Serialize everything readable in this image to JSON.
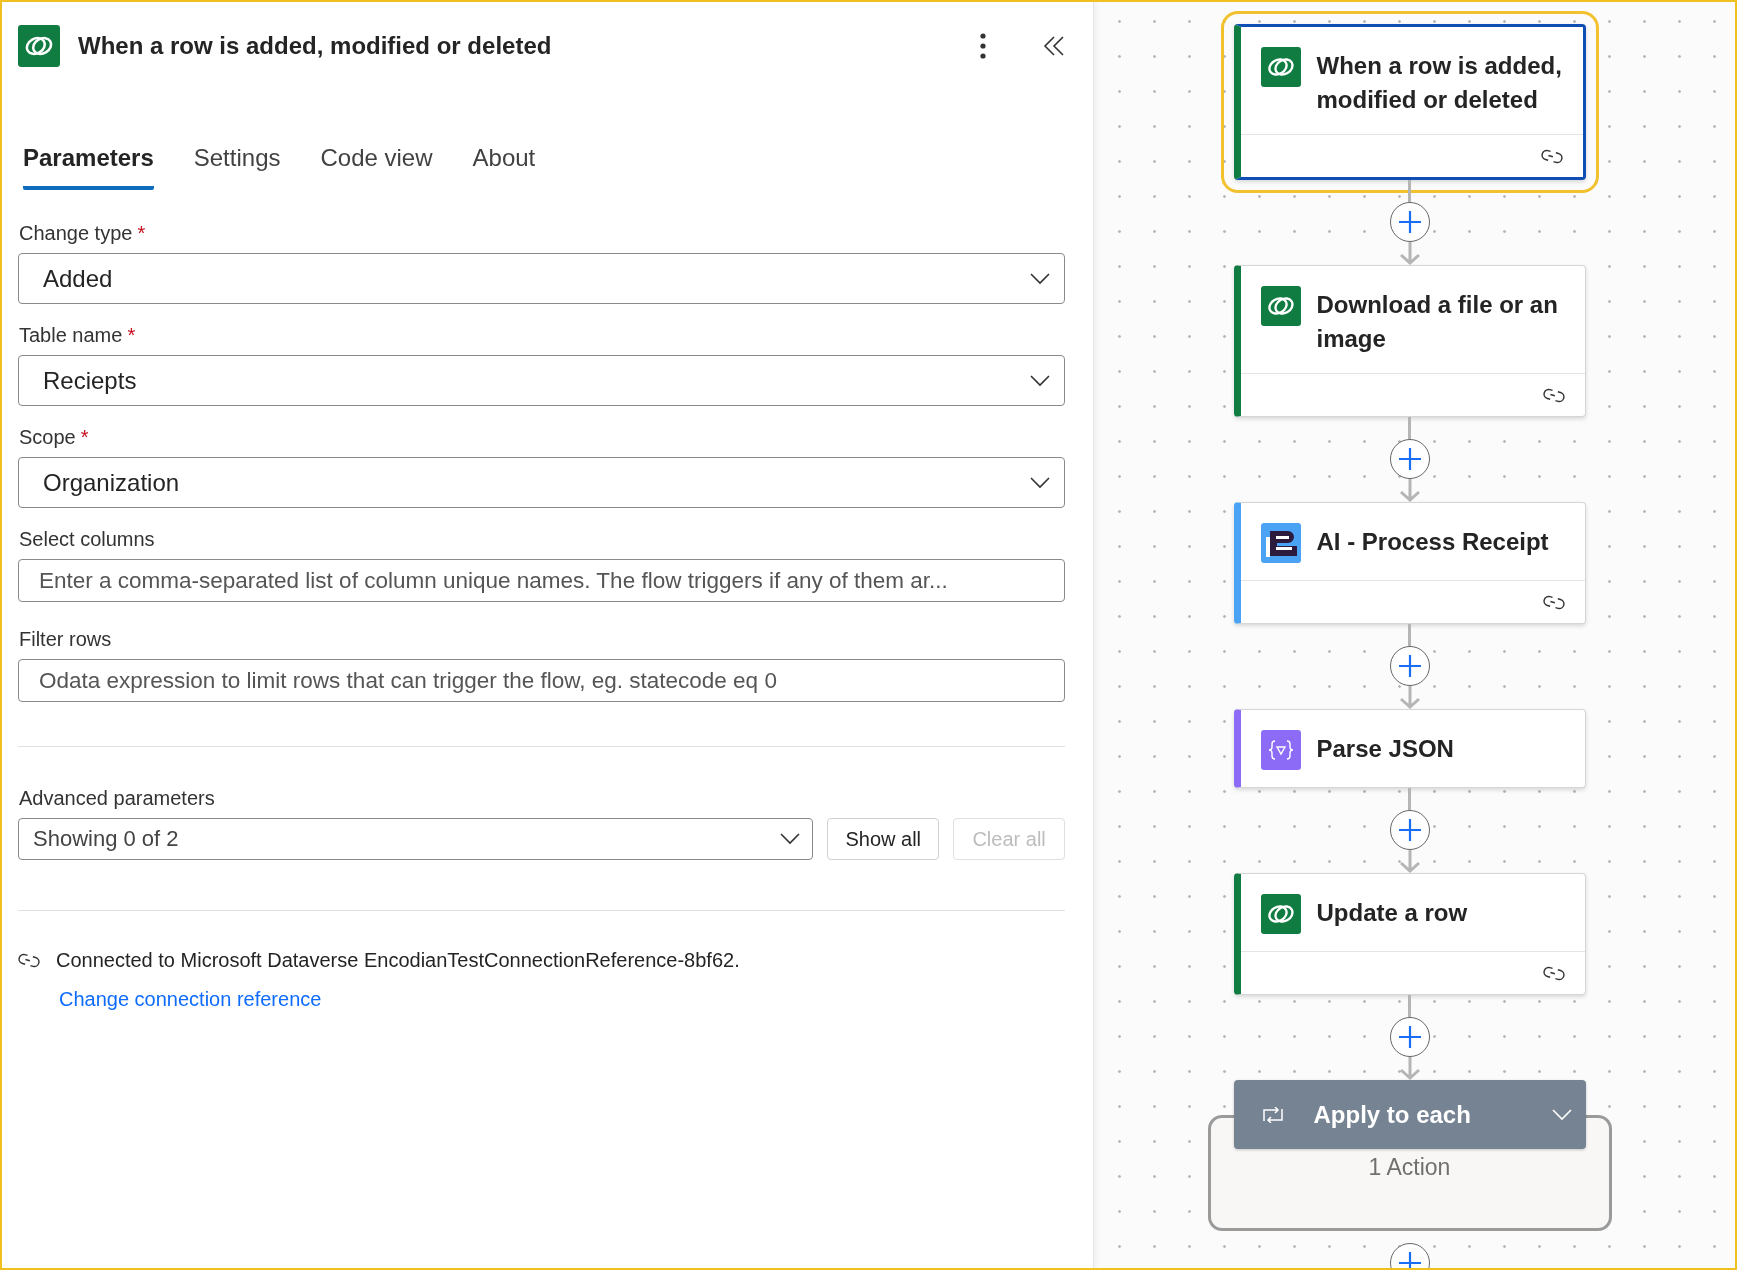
{
  "panel": {
    "title": "When a row is added, modified or deleted",
    "tabs": [
      {
        "label": "Parameters",
        "selected": true
      },
      {
        "label": "Settings",
        "selected": false
      },
      {
        "label": "Code view",
        "selected": false
      },
      {
        "label": "About",
        "selected": false
      }
    ],
    "fields": [
      {
        "kind": "dropdown",
        "label": "Change type",
        "required_mark": "*",
        "value": "Added"
      },
      {
        "kind": "dropdown",
        "label": "Table name",
        "required_mark": "*",
        "value": "Reciepts"
      },
      {
        "kind": "dropdown",
        "label": "Scope",
        "required_mark": "*",
        "value": "Organization"
      },
      {
        "kind": "text",
        "label": "Select columns",
        "placeholder": "Enter a comma-separated list of column unique names. The flow triggers if any of them ar..."
      },
      {
        "kind": "text",
        "label": "Filter rows",
        "placeholder": "Odata expression to limit rows that can trigger the flow, eg. statecode eq 0"
      }
    ],
    "advanced": {
      "label": "Advanced parameters",
      "value": "Showing 0 of 2",
      "buttons": [
        {
          "label": "Show all",
          "disabled": false
        },
        {
          "label": "Clear all",
          "disabled": true
        }
      ]
    },
    "connection": {
      "text": "Connected to Microsoft Dataverse EncodianTestConnectionReference-8bf62.",
      "link": "Change connection reference"
    }
  },
  "flow": {
    "nodes": [
      {
        "kind": "dataverse",
        "title": "When a row is added, modified or deleted",
        "color": "#107c41",
        "selected": true,
        "connected": true
      },
      {
        "kind": "dataverse",
        "title": "Download a file or an image",
        "color": "#107c41",
        "selected": false,
        "connected": true
      },
      {
        "kind": "ai",
        "title": "AI - Process Receipt",
        "color": "#4aa3f5",
        "selected": false,
        "connected": true
      },
      {
        "kind": "json",
        "title": "Parse JSON",
        "color": "#8c6cf7",
        "selected": false,
        "connected": false
      },
      {
        "kind": "dataverse",
        "title": "Update a row",
        "color": "#107c41",
        "selected": false,
        "connected": true
      }
    ],
    "loop": {
      "title": "Apply to each",
      "summary": "1 Action"
    }
  }
}
